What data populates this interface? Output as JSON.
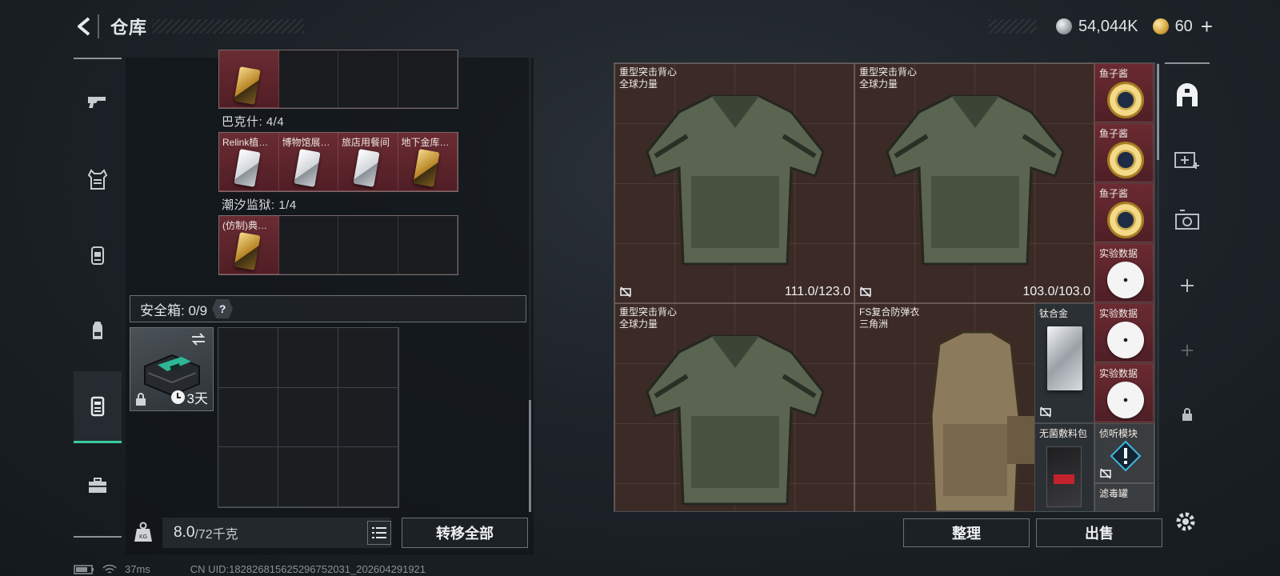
{
  "header": {
    "title": "仓库",
    "currency_silver": "54,044K",
    "currency_gold": "60",
    "add_label": "+"
  },
  "left_nav": [
    {
      "name": "weapons-tab",
      "icon": "pistol-icon",
      "active": false
    },
    {
      "name": "armor-tab",
      "icon": "vest-icon",
      "active": false
    },
    {
      "name": "chest-rig-tab",
      "icon": "chest-rig-icon",
      "active": false
    },
    {
      "name": "backpack-tab",
      "icon": "backpack-icon",
      "active": false
    },
    {
      "name": "keycard-tab",
      "icon": "keycard-icon",
      "active": true
    },
    {
      "name": "toolbox-tab",
      "icon": "toolbox-icon",
      "active": false
    }
  ],
  "keycards": {
    "top_row": [
      {
        "name": "",
        "type": "gold"
      },
      {
        "name": "",
        "type": "empty"
      },
      {
        "name": "",
        "type": "empty"
      },
      {
        "name": "",
        "type": "empty"
      }
    ],
    "section_bakshi": "巴克什: 4/4",
    "bakshi_row": [
      {
        "name": "Relink植…",
        "type": "white"
      },
      {
        "name": "博物馆展…",
        "type": "white"
      },
      {
        "name": "旅店用餐间",
        "type": "white"
      },
      {
        "name": "地下金库…",
        "type": "gold"
      }
    ],
    "section_prison": "潮汐监狱: 1/4",
    "prison_row": [
      {
        "name": "(仿制)典…",
        "type": "gold"
      },
      {
        "name": "",
        "type": "empty"
      },
      {
        "name": "",
        "type": "empty"
      },
      {
        "name": "",
        "type": "empty"
      }
    ]
  },
  "safebox": {
    "label": "安全箱: 0/9",
    "help": "?",
    "days": "3天"
  },
  "weight": {
    "value": "8.0",
    "unit": "/72千克"
  },
  "buttons": {
    "transfer_all": "转移全部",
    "sort": "整理",
    "sell": "出售"
  },
  "inventory": {
    "large_items": [
      {
        "name": "重型突击背心",
        "sub": "全球力量",
        "durability": "111.0/123.0",
        "kind": "heavy"
      },
      {
        "name": "重型突击背心",
        "sub": "全球力量",
        "durability": "103.0/103.0",
        "kind": "heavy"
      },
      {
        "name": "重型突击背心",
        "sub": "全球力量",
        "durability": "",
        "kind": "heavy"
      },
      {
        "name": "FS复合防弹衣",
        "sub": "三角洲",
        "durability": "",
        "kind": "tan"
      }
    ],
    "small_items": [
      {
        "name": "鱼子酱",
        "kind": "caviar"
      },
      {
        "name": "鱼子酱",
        "kind": "caviar"
      },
      {
        "name": "鱼子酱",
        "kind": "caviar"
      },
      {
        "name": "实验数据",
        "kind": "disc"
      },
      {
        "name": "实验数据",
        "kind": "disc"
      },
      {
        "name": "实验数据",
        "kind": "disc"
      }
    ],
    "titanium": "钛合金",
    "sterile_kit": "无菌敷料包",
    "listener_module": "侦听模块",
    "filter_canister": "滤毒罐"
  },
  "right_nav": [
    {
      "name": "stash-home-tab",
      "icon": "stash-home-icon"
    },
    {
      "name": "add-medkit-tab",
      "icon": "medkit-add-icon"
    },
    {
      "name": "camera-tab",
      "icon": "camera-icon"
    },
    {
      "name": "add-slot-tab",
      "icon": "plus-icon"
    },
    {
      "name": "add-slot-dim-tab",
      "icon": "plus-icon"
    },
    {
      "name": "locked-slot-tab",
      "icon": "lock-icon"
    }
  ],
  "status": {
    "ping": "37ms",
    "uid": "CN UID:1828268156252967520​31_202604291921"
  },
  "colors": {
    "accent": "#3bc99e",
    "slot_red": "#5c2329",
    "panel": "#111519"
  }
}
